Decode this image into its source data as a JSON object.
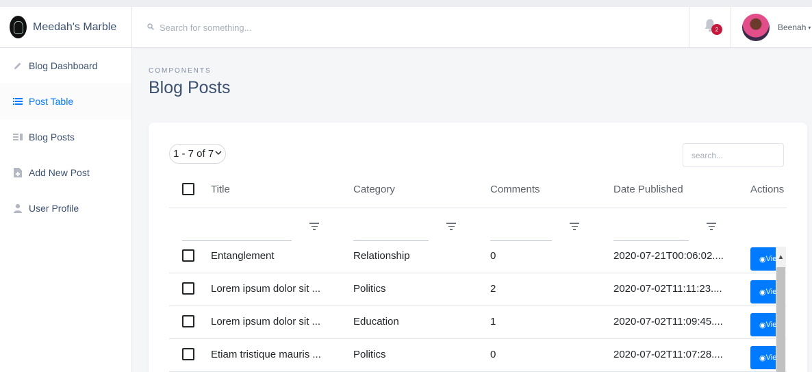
{
  "brand": {
    "name": "Meedah's Marble"
  },
  "sidebar": {
    "items": [
      {
        "label": "Blog Dashboard",
        "icon": "pencil-icon",
        "active": false
      },
      {
        "label": "Post Table",
        "icon": "list-icon",
        "active": true
      },
      {
        "label": "Blog Posts",
        "icon": "posts-icon",
        "active": false
      },
      {
        "label": "Add New Post",
        "icon": "note-add-icon",
        "active": false
      },
      {
        "label": "User Profile",
        "icon": "person-icon",
        "active": false
      }
    ]
  },
  "header": {
    "search_placeholder": "Search for something...",
    "notification_count": "2",
    "user_name": "Beenah"
  },
  "page": {
    "subtitle": "COMPONENTS",
    "title": "Blog Posts"
  },
  "table": {
    "pagination": "1 - 7 of 7",
    "search_placeholder": "search...",
    "columns": [
      "Title",
      "Category",
      "Comments",
      "Date Published",
      "Actions"
    ],
    "rows": [
      {
        "title": "Entanglement",
        "category": "Relationship",
        "comments": "0",
        "date": "2020-07-21T00:06:02....",
        "action": "View"
      },
      {
        "title": "Lorem ipsum dolor sit ...",
        "category": "Politics",
        "comments": "2",
        "date": "2020-07-02T11:11:23....",
        "action": "View"
      },
      {
        "title": "Lorem ipsum dolor sit ...",
        "category": "Education",
        "comments": "1",
        "date": "2020-07-02T11:09:45....",
        "action": "View"
      },
      {
        "title": "Etiam tristique mauris ...",
        "category": "Politics",
        "comments": "0",
        "date": "2020-07-02T11:07:28....",
        "action": "View"
      }
    ]
  },
  "colors": {
    "accent": "#007bff",
    "badge": "#c4183c",
    "text": "#3d5170"
  }
}
